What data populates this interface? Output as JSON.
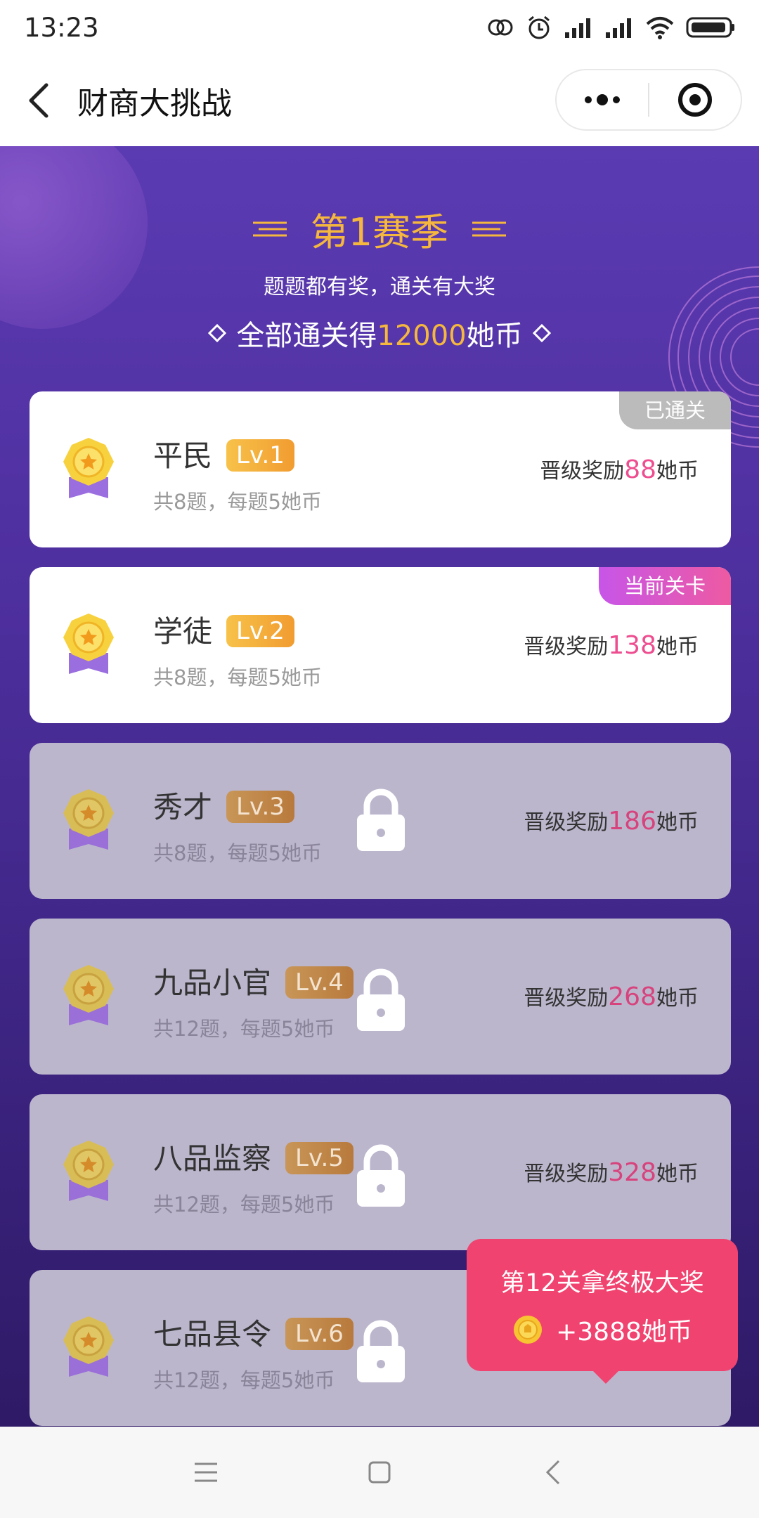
{
  "status_bar": {
    "time": "13:23"
  },
  "nav": {
    "title": "财商大挑战"
  },
  "season": {
    "title": "第1赛季",
    "subtitle": "题题都有奖，通关有大奖",
    "goal_prefix": "全部通关得",
    "goal_amount": "12000",
    "goal_suffix": "她币"
  },
  "levels": [
    {
      "name": "平民",
      "lv": "Lv.1",
      "desc": "共8题，每题5她币",
      "reward_prefix": "晋级奖励",
      "reward_amount": "88",
      "reward_suffix": "她币",
      "tag": "已通关",
      "locked": false
    },
    {
      "name": "学徒",
      "lv": "Lv.2",
      "desc": "共8题，每题5她币",
      "reward_prefix": "晋级奖励",
      "reward_amount": "138",
      "reward_suffix": "她币",
      "tag": "当前关卡",
      "locked": false
    },
    {
      "name": "秀才",
      "lv": "Lv.3",
      "desc": "共8题，每题5她币",
      "reward_prefix": "晋级奖励",
      "reward_amount": "186",
      "reward_suffix": "她币",
      "tag": "",
      "locked": true
    },
    {
      "name": "九品小官",
      "lv": "Lv.4",
      "desc": "共12题，每题5她币",
      "reward_prefix": "晋级奖励",
      "reward_amount": "268",
      "reward_suffix": "她币",
      "tag": "",
      "locked": true
    },
    {
      "name": "八品监察",
      "lv": "Lv.5",
      "desc": "共12题，每题5她币",
      "reward_prefix": "晋级奖励",
      "reward_amount": "328",
      "reward_suffix": "她币",
      "tag": "",
      "locked": true
    },
    {
      "name": "七品县令",
      "lv": "Lv.6",
      "desc": "共12题，每题5她币",
      "reward_prefix": "",
      "reward_amount": "",
      "reward_suffix": "",
      "tag": "",
      "locked": true
    }
  ],
  "prize_popup": {
    "line1": "第12关拿终极大奖",
    "line2": "+3888她币"
  },
  "colors": {
    "accent_gold": "#f5b73d",
    "reward_pink": "#ee4d8f",
    "popup_red": "#f1436f",
    "bg_purple": "#5b3bb2"
  }
}
